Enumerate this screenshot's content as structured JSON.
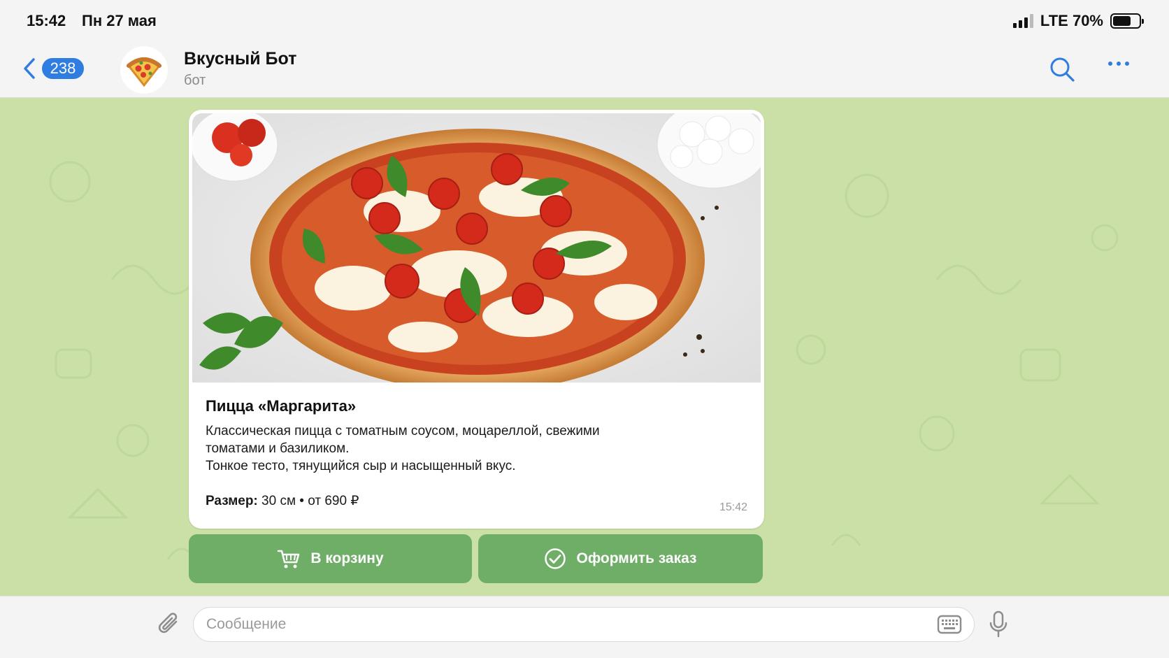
{
  "status_bar": {
    "time": "15:42",
    "date": "Пн 27 мая",
    "network": "LTE",
    "battery_level": "70%",
    "battery_fraction": 0.7
  },
  "header": {
    "back_badge": "238",
    "bot_name": "Вкусный Бот",
    "bot_subtitle": "бот",
    "accent_color": "#2f7de1"
  },
  "message": {
    "title": "Пицца «Маргарита»",
    "description_lines": [
      "Классическая пицца с томатным соусом, моцареллой, свежими",
      "томатами и базиликом.",
      "Тонкое тесто, тянущийся сыр и насыщенный вкус."
    ],
    "size_label": "Размер:",
    "size_value": "30 см",
    "price_sep": "•",
    "price": "от 690 ₽",
    "time": "15:42"
  },
  "buttons": {
    "cart_label": "В корзину",
    "order_label": "Оформить заказ",
    "button_color": "#6fae67"
  },
  "input": {
    "placeholder": "Сообщение"
  },
  "icons": {
    "back": "chevron-left-icon",
    "search": "search-icon",
    "more": "more-dots-icon",
    "cart": "cart-icon",
    "check": "check-circle-icon",
    "attach": "paperclip-icon",
    "keyboard": "keyboard-icon",
    "mic": "microphone-icon"
  },
  "chat_background_color": "#cbe0a6"
}
